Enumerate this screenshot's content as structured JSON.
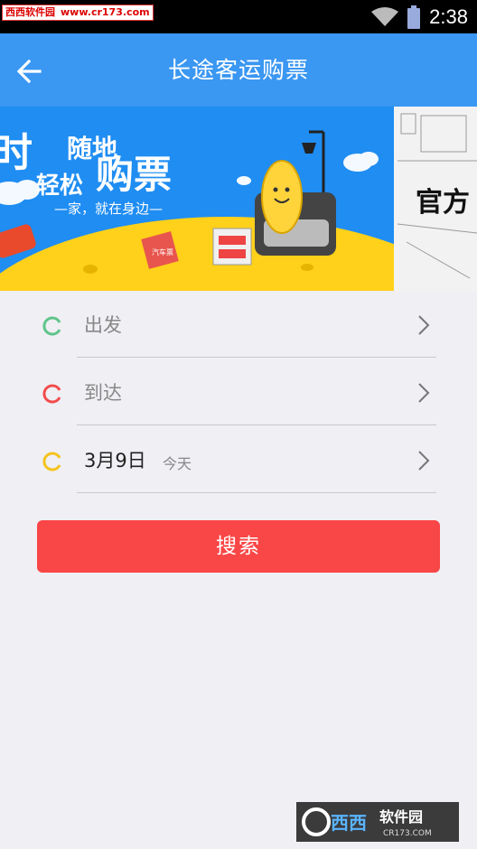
{
  "status_bar": {
    "watermark_name": "西西软件园",
    "watermark_url": "www.cr173.com",
    "time": "2:38",
    "icons": [
      "wifi-icon",
      "battery-icon"
    ]
  },
  "app_bar": {
    "title": "长途客运购票",
    "back_icon": "arrow-left-icon"
  },
  "banner": {
    "headline_1": "时",
    "headline_2": "随地",
    "headline_3": "轻松",
    "headline_4": "购票",
    "tagline": "—家，就在身边—",
    "ticket_label": "汽车票",
    "side_text": "官方"
  },
  "form": {
    "departure": {
      "label": "出发",
      "ring_color": "#5fc48a"
    },
    "arrival": {
      "label": "到达",
      "ring_color": "#f24b4b"
    },
    "date": {
      "label": "3月9日",
      "sub": "今天",
      "ring_color": "#f5c21a"
    }
  },
  "search_button": {
    "label": "搜索"
  },
  "bottom_watermark": {
    "brand": "西西",
    "name": "软件园",
    "url": "CR173.COM"
  },
  "colors": {
    "app_bar": "#3a97f2",
    "search_button": "#f94646",
    "page_background": "#efeff4"
  }
}
